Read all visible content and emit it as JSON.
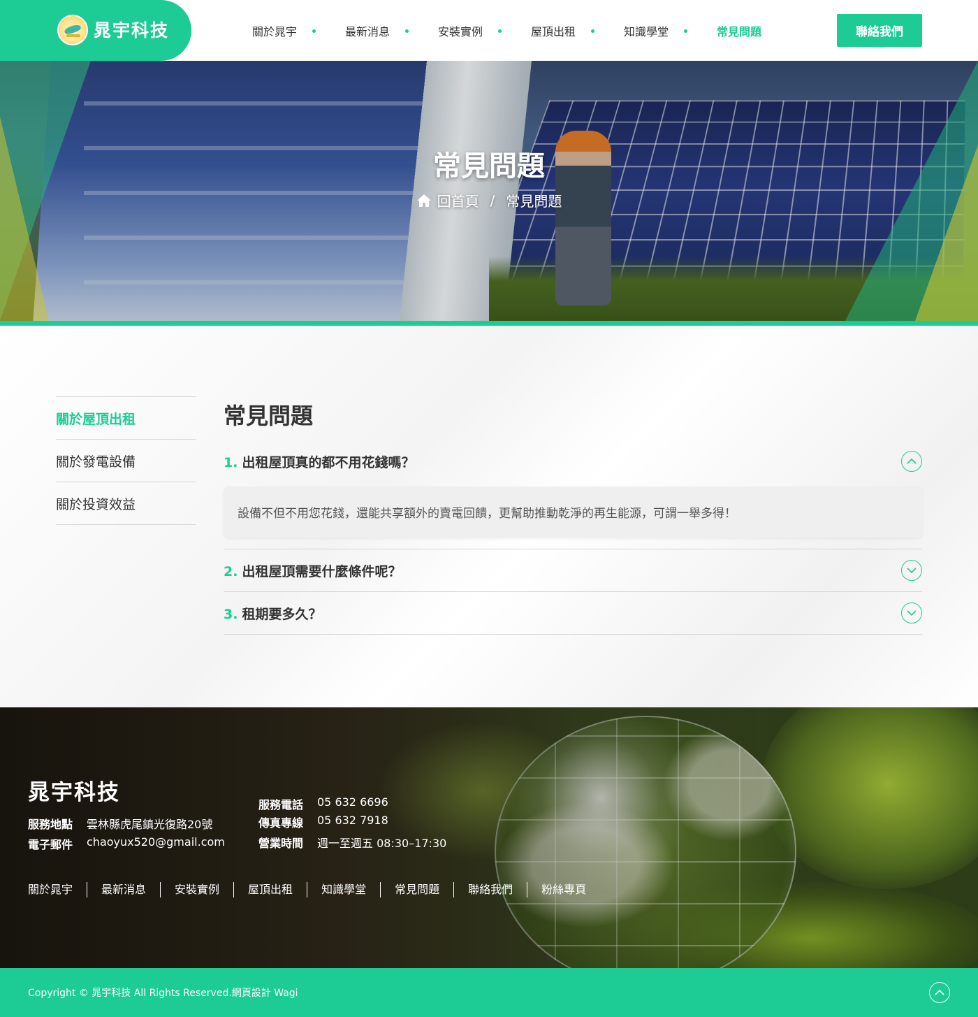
{
  "brand": {
    "name": "晁宇科技"
  },
  "nav": {
    "items": [
      "關於晁宇",
      "最新消息",
      "安裝實例",
      "屋頂出租",
      "知識學堂",
      "常見問題"
    ],
    "active_index": 5,
    "contact_button": "聯絡我們"
  },
  "banner": {
    "title": "常見問題",
    "breadcrumb": {
      "home": "回首頁",
      "separator": "/",
      "current": "常見問題"
    }
  },
  "sidebar": {
    "items": [
      "關於屋頂出租",
      "關於發電設備",
      "關於投資效益"
    ],
    "active_index": 0
  },
  "faq": {
    "title": "常見問題",
    "items": [
      {
        "num": "1.",
        "question": "出租屋頂真的都不用花錢嗎？",
        "answer": "設備不但不用您花錢，還能共享額外的賣電回饋，更幫助推動乾淨的再生能源，可謂一舉多得！",
        "expanded": true
      },
      {
        "num": "2.",
        "question": "出租屋頂需要什麼條件呢？",
        "expanded": false
      },
      {
        "num": "3.",
        "question": "租期要多久？",
        "expanded": false
      }
    ]
  },
  "footer": {
    "brand": "晁宇科技",
    "address_label": "服務地點",
    "address": "雲林縣虎尾鎮光復路20號",
    "email_label": "電子郵件",
    "email": "chaoyux520@gmail.com",
    "phone_label": "服務電話",
    "phone": "05 632 6696",
    "fax_label": "傳真專線",
    "fax": "05 632 7918",
    "hours_label": "營業時間",
    "hours": "週一至週五 08:30–17:30",
    "links": [
      "關於晁宇",
      "最新消息",
      "安裝實例",
      "屋頂出租",
      "知識學堂",
      "常見問題",
      "聯絡我們",
      "粉絲專頁"
    ],
    "copyright": "Copyright © 晁宇科技 All Rights Reserved.網頁設計 Wagi"
  },
  "colors": {
    "accent": "#1dcb95",
    "text": "#333333"
  },
  "icons": {
    "home": "home-icon",
    "expand": "chevron-down-icon",
    "collapse": "chevron-up-icon",
    "back_to_top": "chevron-up-icon"
  }
}
